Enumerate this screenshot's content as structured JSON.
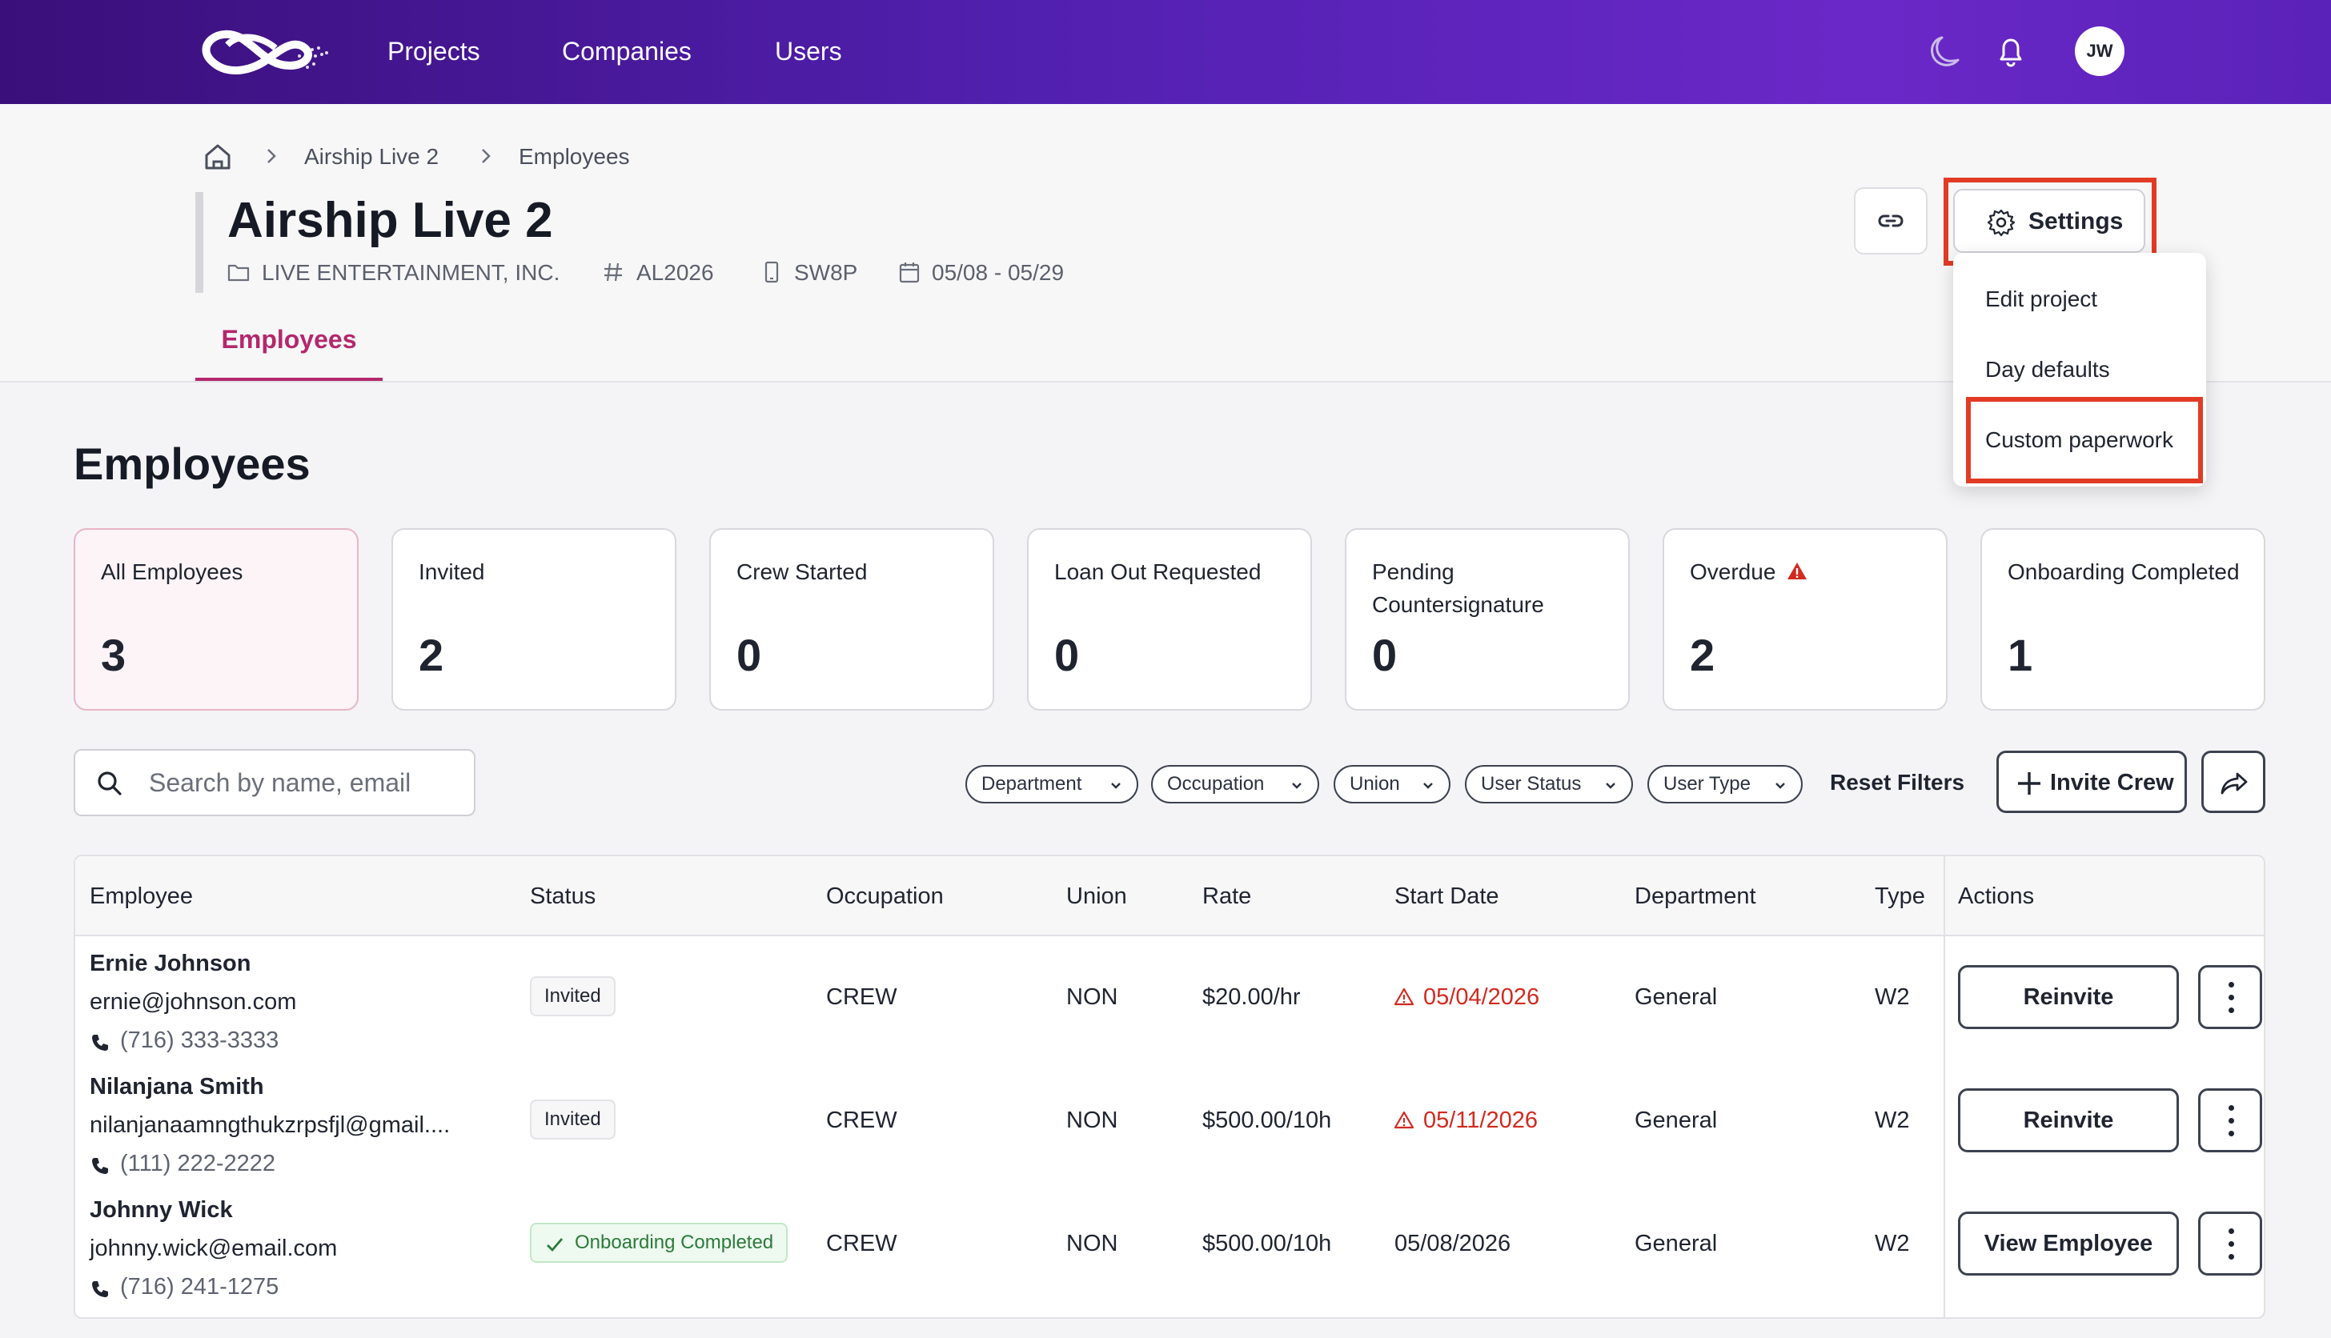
{
  "topnav": {
    "links": [
      "Projects",
      "Companies",
      "Users"
    ],
    "icons": [
      "moon-icon",
      "bell-icon"
    ],
    "avatar_initials": "JW",
    "gradient": [
      "#3a0f7a",
      "#6a28c8"
    ]
  },
  "breadcrumb": {
    "items": [
      "Airship Live 2",
      "Employees"
    ]
  },
  "project": {
    "title": "Airship Live 2",
    "company": "LIVE ENTERTAINMENT, INC.",
    "code": "AL2026",
    "device_code": "SW8P",
    "date_range": "05/08 - 05/29"
  },
  "tabs": {
    "active": "Employees"
  },
  "settings": {
    "label": "Settings",
    "menu": [
      "Edit project",
      "Day defaults",
      "Custom paperwork"
    ]
  },
  "section": {
    "title": "Employees"
  },
  "cards": [
    {
      "label": "All Employees",
      "count": "3"
    },
    {
      "label": "Invited",
      "count": "2"
    },
    {
      "label": "Crew Started",
      "count": "0"
    },
    {
      "label": "Loan Out Requested",
      "count": "0"
    },
    {
      "label": "Pending Countersignature",
      "count": "0"
    },
    {
      "label": "Overdue",
      "count": "2"
    },
    {
      "label": "Onboarding Completed",
      "count": "1"
    }
  ],
  "filters": {
    "search_placeholder": "Search by name, email",
    "chips": [
      "Department",
      "Occupation",
      "Union",
      "User Status",
      "User Type"
    ],
    "reset_label": "Reset Filters",
    "invite_label": "Invite Crew"
  },
  "table": {
    "columns": [
      "Employee",
      "Status",
      "Occupation",
      "Union",
      "Rate",
      "Start Date",
      "Department",
      "Type",
      "Actions"
    ],
    "rows": [
      {
        "name": "Ernie Johnson",
        "email": "ernie@johnson.com",
        "phone": "(716) 333-3333",
        "status": "Invited",
        "occupation": "CREW",
        "union": "NON",
        "rate": "$20.00/hr",
        "start_date": "05/04/2026",
        "start_overdue": true,
        "department": "General",
        "type": "W2",
        "action": "Reinvite"
      },
      {
        "name": "Nilanjana Smith",
        "email": "nilanjanaamngthukzrpsfjl@gmail....",
        "phone": "(111) 222-2222",
        "status": "Invited",
        "occupation": "CREW",
        "union": "NON",
        "rate": "$500.00/10h",
        "start_date": "05/11/2026",
        "start_overdue": true,
        "department": "General",
        "type": "W2",
        "action": "Reinvite"
      },
      {
        "name": "Johnny Wick",
        "email": "johnny.wick@email.com",
        "phone": "(716) 241-1275",
        "status": "Onboarding Completed",
        "occupation": "CREW",
        "union": "NON",
        "rate": "$500.00/10h",
        "start_date": "05/08/2026",
        "start_overdue": false,
        "department": "General",
        "type": "W2",
        "action": "View Employee"
      }
    ]
  },
  "colors": {
    "accent": "#b4286c",
    "warning": "#d22a20",
    "success": "#2c7a3a",
    "annotation": "#e23b24"
  }
}
